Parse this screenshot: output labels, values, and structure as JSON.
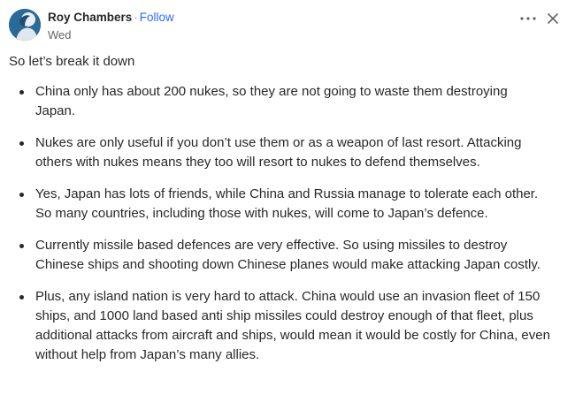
{
  "post": {
    "author": "Roy Chambers",
    "separator": "·",
    "follow_label": "Follow",
    "date": "Wed",
    "more_icon": "more-dots-icon",
    "close_icon": "close-icon",
    "intro": "So let’s break it down",
    "points": [
      "China only has about 200 nukes, so they are not going to waste them destroying Japan.",
      "Nukes are only useful if you don’t use them or as a weapon of last resort. Attacking others with nukes means they too will resort to nukes to defend themselves.",
      "Yes, Japan has lots of friends, while China and Russia manage to tolerate each other. So many countries, including those with nukes, will come to Japan’s defence.",
      "Currently missile based defences are very effective. So using missiles to destroy Chinese ships and shooting down Chinese planes would make attacking Japan costly.",
      "Plus, any island nation is very hard to attack. China would use an invasion fleet of 150 ships, and 1000 land based anti ship missiles could destroy enough of that fleet, plus additional attacks from aircraft and ships, would mean it would be costly for China, even without help from Japan’s many allies."
    ]
  },
  "colors": {
    "text": "#282829",
    "follow": "#2e69ff",
    "muted": "#636466"
  }
}
